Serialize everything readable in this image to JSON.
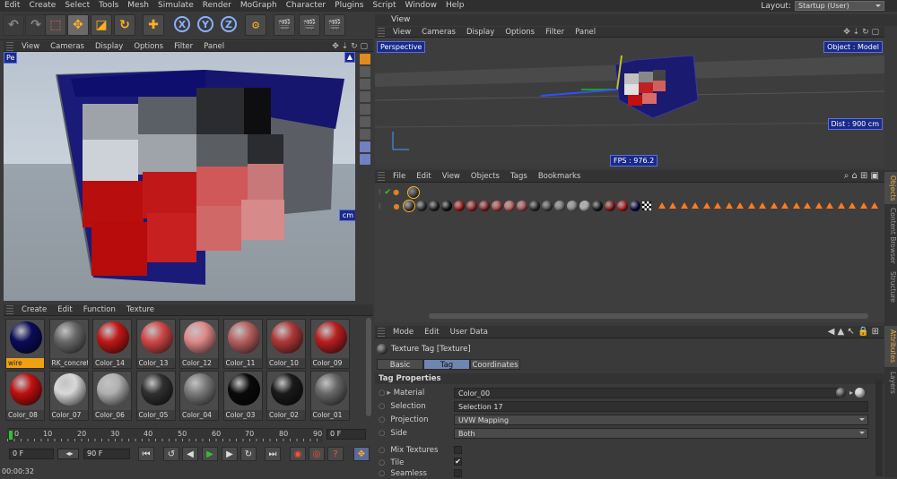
{
  "menu": [
    "Edit",
    "Create",
    "Select",
    "Tools",
    "Mesh",
    "Simulate",
    "Render",
    "MoGraph",
    "Character",
    "Plugins",
    "Script",
    "Window",
    "Help"
  ],
  "layout": {
    "label": "Layout:",
    "value": "Startup (User)"
  },
  "left_viewport": {
    "menu": [
      "View",
      "Cameras",
      "Display",
      "Options",
      "Filter",
      "Panel"
    ],
    "label_partial": "Pe",
    "dist_partial": "cm"
  },
  "right_view_title": "View",
  "right_viewport": {
    "menu": [
      "View",
      "Cameras",
      "Display",
      "Options",
      "Filter",
      "Panel"
    ],
    "perspective": "Perspective",
    "object": "Object : Model",
    "dist": "Dist : 900 cm",
    "fps": "FPS : 976.2"
  },
  "object_manager": {
    "menu": [
      "File",
      "Edit",
      "View",
      "Objects",
      "Tags",
      "Bookmarks"
    ],
    "tag_colors": [
      "#4a4a4a",
      "#3a3a3a",
      "#2a2a2a",
      "#161616",
      "#c02020",
      "#b03030",
      "#9a3030",
      "#d05050",
      "#e07070",
      "#c06060",
      "#333",
      "#555",
      "#888",
      "#a0a0a0",
      "#c8c8c8",
      "#202020",
      "#a02020",
      "#d02020",
      "#0a0a50"
    ]
  },
  "material_manager": {
    "menu": [
      "Create",
      "Edit",
      "Function",
      "Texture"
    ],
    "materials": [
      {
        "name": "wire",
        "color": "#0b0b5a",
        "sel": true
      },
      {
        "name": "RK_concret",
        "color": "#6a6a6a"
      },
      {
        "name": "Color_14",
        "color": "#c01818"
      },
      {
        "name": "Color_13",
        "color": "#d04848"
      },
      {
        "name": "Color_12",
        "color": "#e08a8a"
      },
      {
        "name": "Color_11",
        "color": "#b86060"
      },
      {
        "name": "Color_10",
        "color": "#b03838"
      },
      {
        "name": "Color_09",
        "color": "#b82020"
      },
      {
        "name": "Color_08",
        "color": "#c01010"
      },
      {
        "name": "Color_07",
        "color": "#d8d8d8"
      },
      {
        "name": "Color_06",
        "color": "#b0b0b0"
      },
      {
        "name": "Color_05",
        "color": "#303030"
      },
      {
        "name": "Color_04",
        "color": "#7a7a7a"
      },
      {
        "name": "Color_03",
        "color": "#0a0a0a"
      },
      {
        "name": "Color_02",
        "color": "#1a1a1a"
      },
      {
        "name": "Color_01",
        "color": "#686868"
      }
    ]
  },
  "timeline": {
    "ticks": [
      "0",
      "10",
      "20",
      "30",
      "40",
      "50",
      "60",
      "70",
      "80",
      "90"
    ],
    "frame": "0 F",
    "start": "0 F",
    "end": "90 F",
    "time": "00:00:32"
  },
  "attributes": {
    "menu": [
      "Mode",
      "Edit",
      "User Data"
    ],
    "title": "Texture Tag [Texture]",
    "tabs": [
      "Basic",
      "Tag",
      "Coordinates"
    ],
    "active_tab": "Tag",
    "section": "Tag Properties",
    "props": [
      {
        "label": "Material",
        "value": "Color_00"
      },
      {
        "label": "Selection",
        "value": "Selection 17"
      },
      {
        "label": "Projection",
        "value": "UVW Mapping"
      },
      {
        "label": "Side",
        "value": "Both"
      }
    ],
    "checks": [
      {
        "label": "Mix Textures",
        "checked": false
      },
      {
        "label": "Tile",
        "checked": true
      },
      {
        "label": "Seamless",
        "checked": false
      }
    ]
  },
  "right_tabs": [
    "Objects",
    "Content Browser",
    "Structure",
    "Attributes",
    "Layers"
  ]
}
